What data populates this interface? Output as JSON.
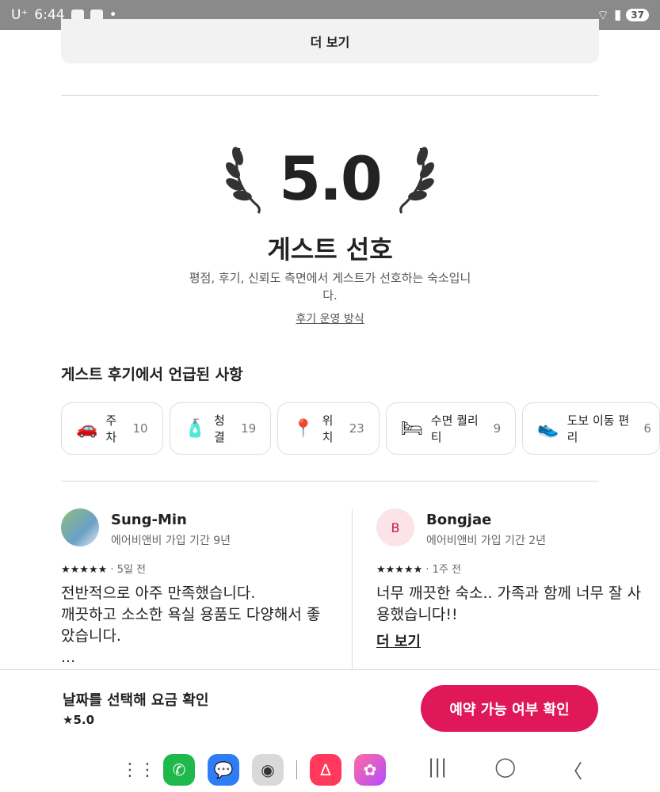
{
  "status_bar": {
    "carrier": "U⁺",
    "time": "6:44",
    "battery": "37"
  },
  "top_more": {
    "label": "더 보기"
  },
  "rating_block": {
    "score": "5.0",
    "title": "게스트 선호",
    "subtitle": "평점, 후기, 신뢰도 측면에서 게스트가 선호하는 숙소입니다.",
    "policy_link": "후기 운영 방식"
  },
  "mentioned": {
    "heading": "게스트 후기에서 언급된 사항",
    "chips": [
      {
        "icon": "car-icon",
        "glyph": "🚗",
        "label": "주차",
        "count": "10"
      },
      {
        "icon": "cleaning-icon",
        "glyph": "🧴",
        "label": "청결",
        "count": "19"
      },
      {
        "icon": "location-pin-icon",
        "glyph": "📍",
        "label": "위치",
        "count": "23"
      },
      {
        "icon": "bed-icon",
        "glyph": "🛏",
        "label": "수면 퀄리티",
        "count": "9"
      },
      {
        "icon": "sneaker-icon",
        "glyph": "👟",
        "label": "도보 이동 편리",
        "count": "6"
      }
    ]
  },
  "reviews": [
    {
      "name": "Sung-Min",
      "meta": "에어비앤비 가입 기간 9년",
      "stars": "★★★★★",
      "when": "· 5일 전",
      "text": "전반적으로 아주 만족했습니다.\n깨끗하고 소소한 욕실 용품도 다양해서 좋았습니다.\n...",
      "more": ""
    },
    {
      "name": "Bongjae",
      "initial": "B",
      "meta": "에어비앤비 가입 기간 2년",
      "stars": "★★★★★",
      "when": "· 1주 전",
      "text": "너무 깨끗한 숙소.. 가족과 함께 너무 잘 사용했습니다!!",
      "more": "더 보기"
    }
  ],
  "booking_bar": {
    "prompt": "날짜를 선택해 요금 확인",
    "rating": "★5.0",
    "cta": "예약 가능 여부 확인"
  },
  "colors": {
    "brand": "#e0185a",
    "statusbar": "#8a8a8a"
  }
}
